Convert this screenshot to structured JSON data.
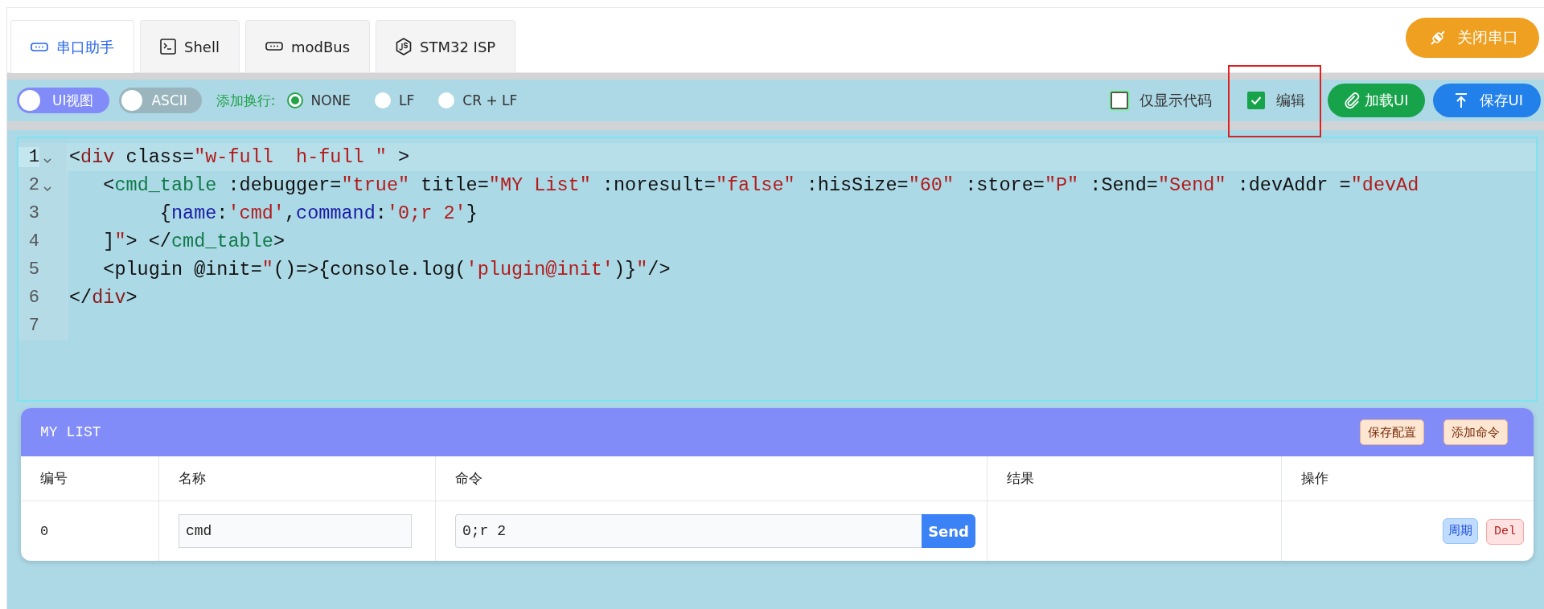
{
  "tabs": [
    {
      "label": "串口助手",
      "selected": true
    },
    {
      "label": "Shell",
      "selected": false
    },
    {
      "label": "modBus",
      "selected": false
    },
    {
      "label": "STM32 ISP",
      "selected": false
    }
  ],
  "close_port_button": "关闭串口",
  "toolbar": {
    "switches": [
      {
        "label": "UI视图",
        "on": true
      },
      {
        "label": "ASCII",
        "on": false
      }
    ],
    "newline_label": "添加换行:",
    "newline_options": [
      {
        "label": "NONE",
        "selected": true
      },
      {
        "label": "LF",
        "selected": false
      },
      {
        "label": "CR + LF",
        "selected": false
      }
    ],
    "checkboxes": [
      {
        "label": "仅显示代码",
        "checked": false,
        "highlighted": false
      },
      {
        "label": "编辑",
        "checked": true,
        "highlighted": true
      }
    ],
    "buttons": [
      {
        "label": "加载UI",
        "kind": "load"
      },
      {
        "label": "保存UI",
        "kind": "save"
      }
    ]
  },
  "editor": {
    "lines": [
      {
        "number": "1",
        "foldable": true,
        "active": true,
        "tokens": [
          {
            "kind": "punct",
            "text": "<"
          },
          {
            "kind": "tag",
            "text": "div"
          },
          {
            "kind": "attr",
            "text": " class="
          },
          {
            "kind": "string",
            "text": "\"w-full  h-full \""
          },
          {
            "kind": "punct",
            "text": " >"
          }
        ]
      },
      {
        "number": "2",
        "foldable": true,
        "active": false,
        "tokens": [
          {
            "kind": "punct",
            "text": "   <"
          },
          {
            "kind": "component",
            "text": "cmd_table"
          },
          {
            "kind": "attr",
            "text": " :debugger="
          },
          {
            "kind": "string",
            "text": "\"true\""
          },
          {
            "kind": "attr",
            "text": " title="
          },
          {
            "kind": "string",
            "text": "\"MY List\""
          },
          {
            "kind": "attr",
            "text": " :noresult="
          },
          {
            "kind": "string",
            "text": "\"false\""
          },
          {
            "kind": "attr",
            "text": " :hisSize="
          },
          {
            "kind": "string",
            "text": "\"60\""
          },
          {
            "kind": "attr",
            "text": " :store="
          },
          {
            "kind": "string",
            "text": "\"P\""
          },
          {
            "kind": "attr",
            "text": " :Send="
          },
          {
            "kind": "string",
            "text": "\"Send\""
          },
          {
            "kind": "attr",
            "text": " :devAddr ="
          },
          {
            "kind": "string",
            "text": "\"devAd"
          }
        ]
      },
      {
        "number": "3",
        "foldable": false,
        "active": false,
        "tokens": [
          {
            "kind": "punct",
            "text": "        {"
          },
          {
            "kind": "key",
            "text": "name"
          },
          {
            "kind": "punct",
            "text": ":"
          },
          {
            "kind": "string",
            "text": "'cmd'"
          },
          {
            "kind": "punct",
            "text": ","
          },
          {
            "kind": "key",
            "text": "command"
          },
          {
            "kind": "punct",
            "text": ":"
          },
          {
            "kind": "string",
            "text": "'0;r 2'"
          },
          {
            "kind": "punct",
            "text": "}"
          }
        ]
      },
      {
        "number": "4",
        "foldable": false,
        "active": false,
        "tokens": [
          {
            "kind": "punct",
            "text": "   ]"
          },
          {
            "kind": "string",
            "text": "\""
          },
          {
            "kind": "punct",
            "text": "> </"
          },
          {
            "kind": "component",
            "text": "cmd_table"
          },
          {
            "kind": "punct",
            "text": ">"
          }
        ]
      },
      {
        "number": "5",
        "foldable": false,
        "active": false,
        "tokens": [
          {
            "kind": "punct",
            "text": "   <plugin @init="
          },
          {
            "kind": "string",
            "text": "\""
          },
          {
            "kind": "punct",
            "text": "()=>{console.log("
          },
          {
            "kind": "string",
            "text": "'plugin@init'"
          },
          {
            "kind": "punct",
            "text": ")}"
          },
          {
            "kind": "string",
            "text": "\""
          },
          {
            "kind": "punct",
            "text": "/>"
          }
        ]
      },
      {
        "number": "6",
        "foldable": false,
        "active": false,
        "tokens": [
          {
            "kind": "punct",
            "text": "</"
          },
          {
            "kind": "tag",
            "text": "div"
          },
          {
            "kind": "punct",
            "text": ">"
          }
        ]
      },
      {
        "number": "7",
        "foldable": false,
        "active": false
      }
    ]
  },
  "cmd_panel": {
    "title": "MY LIST",
    "buttons": [
      "保存配置",
      "添加命令"
    ],
    "columns": [
      "编号",
      "名称",
      "命令",
      "结果",
      "操作"
    ],
    "rows": [
      {
        "id": "0",
        "name": "cmd",
        "command": "0;r 2",
        "send": "Send",
        "actions": [
          {
            "label": "周期",
            "kind": "cycle"
          },
          {
            "label": "Del",
            "kind": "delete"
          }
        ]
      }
    ]
  }
}
